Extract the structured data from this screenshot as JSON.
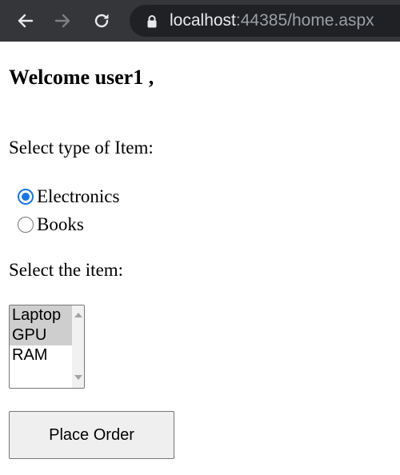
{
  "browser": {
    "url_host": "localhost",
    "url_rest": ":44385/home.aspx",
    "icons": [
      "back-arrow-icon",
      "forward-arrow-icon",
      "reload-icon",
      "lock-icon"
    ]
  },
  "page": {
    "welcome": "Welcome user1 ,",
    "type_label": "Select type of Item:",
    "item_type_options": [
      {
        "label": "Electronics",
        "checked": true
      },
      {
        "label": "Books",
        "checked": false
      }
    ],
    "item_label": "Select the item:",
    "items": [
      {
        "label": "Laptop",
        "selected": true
      },
      {
        "label": "GPU",
        "selected": true
      },
      {
        "label": "RAM",
        "selected": false
      }
    ],
    "order_button": "Place Order"
  },
  "colors": {
    "toolbar": "#35363a",
    "omnibox": "#202124",
    "radio_accent": "#1a73e8",
    "selected_option": "#cecece",
    "button_bg": "#efefef"
  }
}
